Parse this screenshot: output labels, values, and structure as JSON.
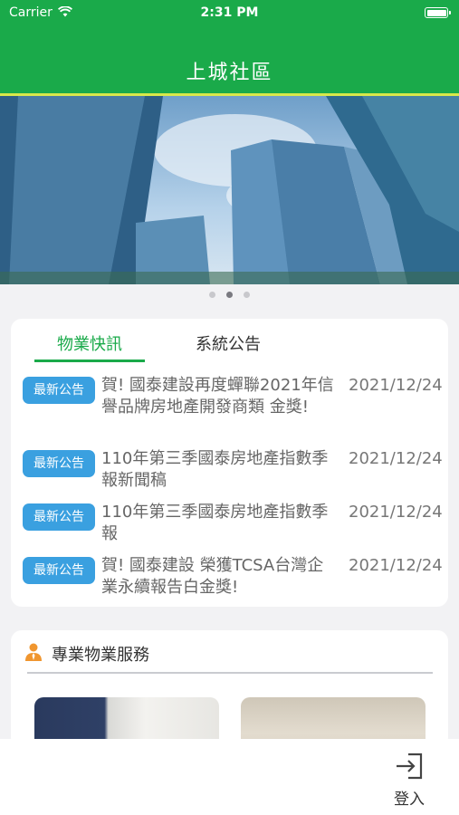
{
  "status_bar": {
    "carrier": "Carrier",
    "time": "2:31 PM"
  },
  "header": {
    "title": "上城社區"
  },
  "carousel": {
    "page_count": 3,
    "active_index": 1
  },
  "news_card": {
    "tabs": [
      {
        "label": "物業快訊",
        "active": true
      },
      {
        "label": "系統公告",
        "active": false
      }
    ],
    "items": [
      {
        "badge": "最新公告",
        "text": "賀! 國泰建設再度蟬聯2021年信譽品牌房地產開發商類 金獎!",
        "date": "2021/12/24"
      },
      {
        "badge": "最新公告",
        "text": "110年第三季國泰房地產指數季報新聞稿",
        "date": "2021/12/24"
      },
      {
        "badge": "最新公告",
        "text": "110年第三季國泰房地產指數季報",
        "date": "2021/12/24"
      },
      {
        "badge": "最新公告",
        "text": "賀! 國泰建設 榮獲TCSA台灣企業永續報告白金獎!",
        "date": "2021/12/24"
      }
    ]
  },
  "services": {
    "title": "專業物業服務",
    "icon": "person-icon"
  },
  "tabbar": {
    "login_label": "登入",
    "login_icon": "login-icon"
  },
  "colors": {
    "brand_green": "#1aaa4a",
    "header_accent": "#d9e84a",
    "badge_blue": "#3aa0e0",
    "service_icon_orange": "#f0962f"
  }
}
